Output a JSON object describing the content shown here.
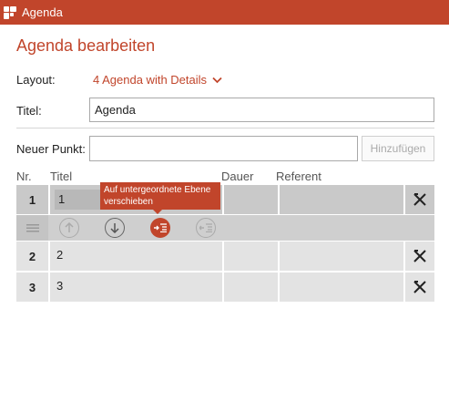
{
  "window": {
    "title": "Agenda",
    "app_icon": "app-logo-icon"
  },
  "page": {
    "heading": "Agenda bearbeiten"
  },
  "form": {
    "layout_label": "Layout:",
    "layout_value": "4 Agenda with Details",
    "titel_label": "Titel:",
    "titel_value": "Agenda",
    "neuer_punkt_label": "Neuer Punkt:",
    "neuer_punkt_value": "",
    "add_button": "Hinzufügen"
  },
  "table": {
    "columns": [
      "Nr.",
      "Titel",
      "Dauer",
      "Referent"
    ],
    "rows": [
      {
        "nr": "1",
        "titel": "1",
        "dauer": "",
        "referent": "",
        "selected": true
      },
      {
        "nr": "2",
        "titel": "2",
        "dauer": "",
        "referent": "",
        "selected": false
      },
      {
        "nr": "3",
        "titel": "3",
        "dauer": "",
        "referent": "",
        "selected": false
      }
    ]
  },
  "row_toolbar": {
    "tooltip": "Auf untergeordnete Ebene verschieben",
    "buttons": [
      "drag-handle-icon",
      "move-up-icon",
      "move-down-icon",
      "indent-icon",
      "outdent-icon"
    ]
  },
  "colors": {
    "accent": "#c1452b",
    "row_bg": "#e3e3e3",
    "row_selected_bg": "#c9c9c9"
  }
}
